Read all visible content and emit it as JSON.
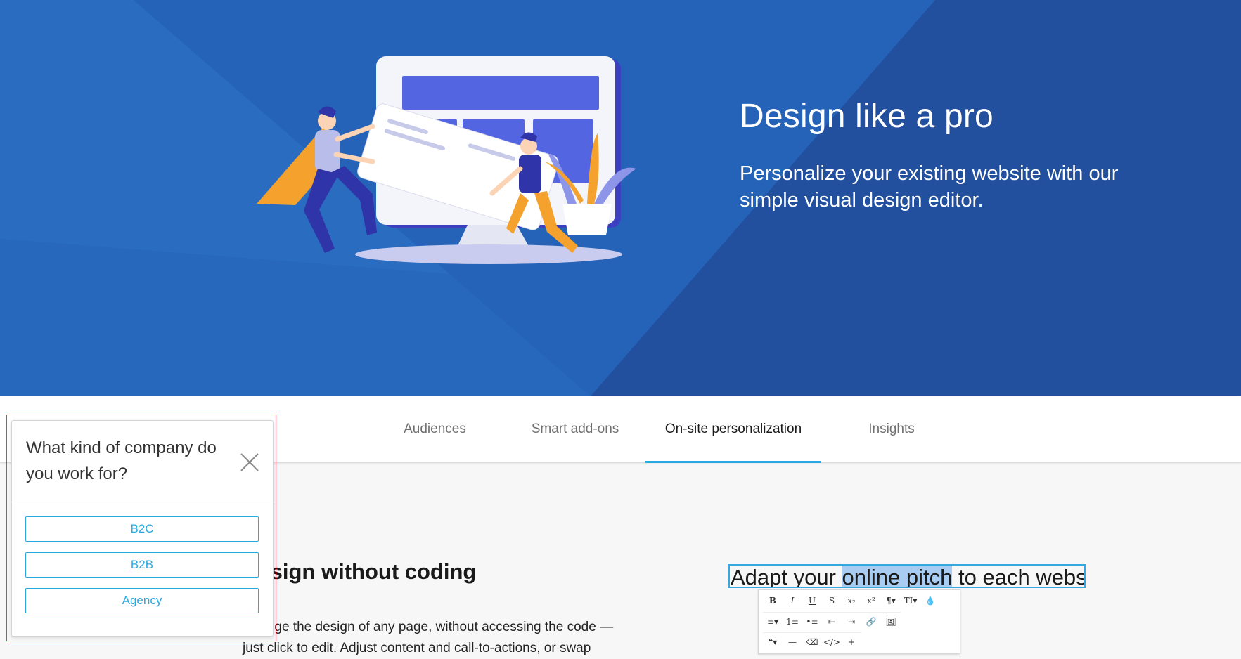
{
  "hero": {
    "title": "Design like a pro",
    "subtitle": "Personalize your existing website with our simple visual design editor.",
    "background_color": "#2560b2",
    "illustration_icon": "website-builders-illustration"
  },
  "tabs": [
    {
      "label": "Audiences",
      "active": false
    },
    {
      "label": "Smart add-ons",
      "active": false
    },
    {
      "label": "On-site personalization",
      "active": true
    },
    {
      "label": "Insights",
      "active": false
    }
  ],
  "tab_accent_color": "#28a9e0",
  "content": {
    "heading": "Design without coding",
    "text": "Change the design of any page, without accessing the code — just click to edit. Adjust content and call-to-actions, or swap"
  },
  "editor_demo": {
    "text_before": "Adapt your ",
    "text_selected": "online pitch",
    "text_after": " to each website",
    "toolbar_row1": [
      "B",
      "I",
      "U",
      "S",
      "x₂",
      "x²",
      "¶▾",
      "TI▾",
      "💧"
    ],
    "toolbar_row2": [
      "≡▾",
      "1≡",
      "•≡",
      "⇤",
      "⇥",
      "🔗",
      "🖼"
    ],
    "toolbar_row3": [
      "❝▾",
      "—",
      "⌫",
      "</>",
      "+"
    ]
  },
  "popup": {
    "question": "What kind of company do you work for?",
    "options": [
      "B2C",
      "B2B",
      "Agency"
    ],
    "accent_color": "#28a9e0",
    "close_icon": "close-icon"
  }
}
